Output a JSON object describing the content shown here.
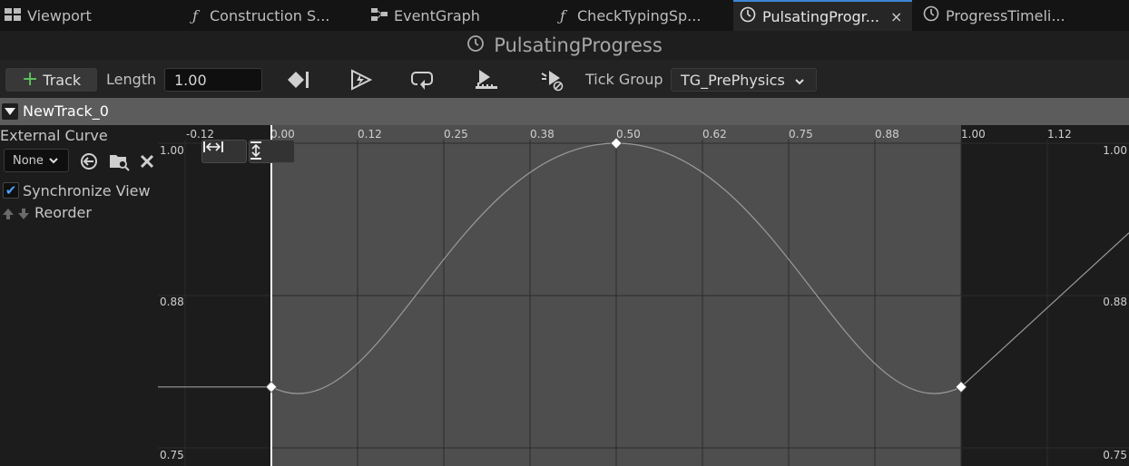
{
  "tabs": [
    {
      "label": "Viewport",
      "icon": "viewport-icon"
    },
    {
      "label": "Construction S...",
      "icon": "function-icon"
    },
    {
      "label": "EventGraph",
      "icon": "graph-icon"
    },
    {
      "label": "CheckTypingSp...",
      "icon": "function-icon"
    },
    {
      "label": "PulsatingProgr...",
      "icon": "clock-icon",
      "active": true,
      "close": "×"
    },
    {
      "label": "ProgressTimeli...",
      "icon": "clock-icon"
    }
  ],
  "title": "PulsatingProgress",
  "toolbar": {
    "track_label": "Track",
    "length_label": "Length",
    "length_value": "1.00",
    "tick_group_label": "Tick Group",
    "tick_group_value": "TG_PrePhysics"
  },
  "track": {
    "name": "NewTrack_0"
  },
  "side": {
    "external_curve_label": "External Curve",
    "curve_select": "None",
    "sync_label": "Synchronize View",
    "sync_checked": true,
    "reorder_label": "Reorder"
  },
  "graph": {
    "time_ticks": [
      "-0.12",
      "0.00",
      "0.12",
      "0.25",
      "0.38",
      "0.50",
      "0.62",
      "0.75",
      "0.88",
      "1.00",
      "1.12"
    ],
    "value_labels_left": [
      "1.00",
      "0.88",
      "0.75"
    ],
    "value_labels_right": [
      "1.00",
      "0.88",
      "0.75"
    ],
    "keys": [
      {
        "time": 0.0,
        "value": 0.8
      },
      {
        "time": 0.5,
        "value": 1.0
      },
      {
        "time": 1.0,
        "value": 0.8
      }
    ],
    "colors": {
      "active_range": "#4e4e4e",
      "outside": "#1c1c1c",
      "curve": "#9a9a9a",
      "playhead": "#ffffff"
    }
  }
}
